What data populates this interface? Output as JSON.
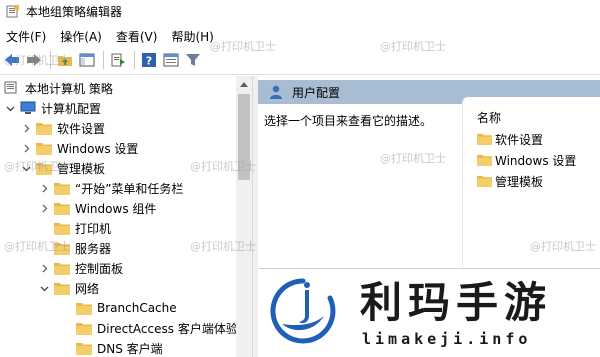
{
  "window": {
    "title": "本地组策略编辑器"
  },
  "menu": [
    {
      "label": "文件(F)"
    },
    {
      "label": "操作(A)"
    },
    {
      "label": "查看(V)"
    },
    {
      "label": "帮助(H)"
    }
  ],
  "tree": {
    "root": "本地计算机 策略",
    "items": [
      {
        "label": "计算机配置"
      },
      {
        "label": "软件设置"
      },
      {
        "label": "Windows 设置"
      },
      {
        "label": "管理模板"
      },
      {
        "label": "“开始”菜单和任务栏"
      },
      {
        "label": "Windows 组件"
      },
      {
        "label": "打印机"
      },
      {
        "label": "服务器"
      },
      {
        "label": "控制面板"
      },
      {
        "label": "网络"
      },
      {
        "label": "BranchCache"
      },
      {
        "label": "DirectAccess 客户端体验"
      },
      {
        "label": "DNS 客户端"
      }
    ]
  },
  "right_pane": {
    "header": "用户配置",
    "description": "选择一个项目来查看它的描述。",
    "column_header": "名称",
    "items": [
      {
        "label": "软件设置"
      },
      {
        "label": "Windows 设置"
      },
      {
        "label": "管理模板"
      }
    ]
  },
  "watermark_text": "@打印机卫士",
  "logo": {
    "cn": "利玛手游",
    "en": "limakeji.info"
  },
  "colors": {
    "folder": "#e8b84a",
    "header_bg": "#a8bcd2",
    "logo_blue": "#1f5fb8"
  }
}
